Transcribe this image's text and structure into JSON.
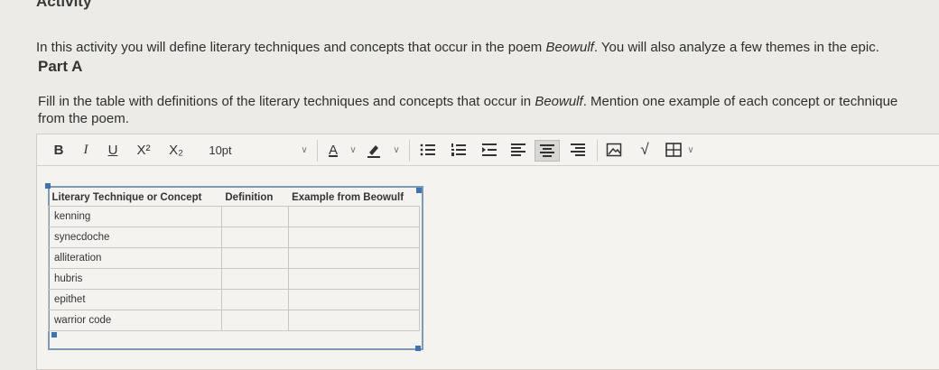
{
  "heading": "Activity",
  "intro": {
    "before": "In this activity you will define literary techniques and concepts that occur in the poem ",
    "italic": "Beowulf",
    "after": ". You will also analyze a few themes in the epic."
  },
  "part_label": "Part A",
  "instruction": {
    "before": "Fill in the table with definitions of the literary techniques and concepts that occur in ",
    "italic": "Beowulf",
    "after": ". Mention one example of each concept or technique from the poem."
  },
  "toolbar": {
    "bold": "B",
    "italic": "I",
    "underline": "U",
    "superscript": "X²",
    "subscript": "X₂",
    "font_size": "10pt",
    "caret": "∨",
    "font_color": "A",
    "math": "√"
  },
  "table": {
    "headers": [
      "Literary Technique or Concept",
      "Definition",
      "Example from Beowulf"
    ],
    "rows": [
      "kenning",
      "synecdoche",
      "alliteration",
      "hubris",
      "epithet",
      "warrior code"
    ]
  }
}
